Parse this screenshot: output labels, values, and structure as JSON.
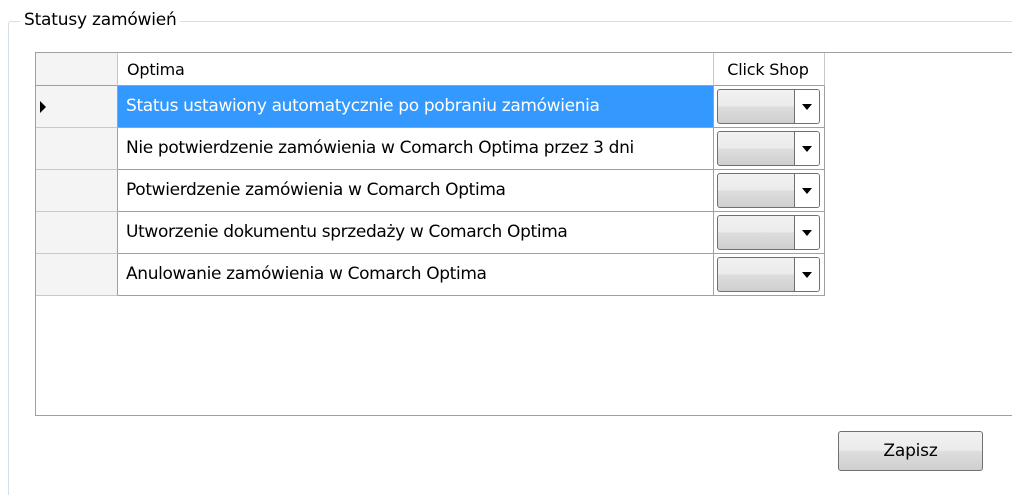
{
  "groupbox": {
    "title": "Statusy zamówień"
  },
  "grid": {
    "columns": [
      "Optima",
      "Click Shop"
    ],
    "rows": [
      {
        "optima": "Status ustawiony automatycznie po pobraniu zamówienia",
        "click_shop": "",
        "selected": true,
        "current": true
      },
      {
        "optima": "Nie potwierdzenie zamówienia w Comarch Optima przez 3 dni",
        "click_shop": "",
        "selected": false,
        "current": false
      },
      {
        "optima": "Potwierdzenie zamówienia w Comarch Optima",
        "click_shop": "",
        "selected": false,
        "current": false
      },
      {
        "optima": "Utworzenie dokumentu sprzedaży w Comarch Optima",
        "click_shop": "",
        "selected": false,
        "current": false
      },
      {
        "optima": "Anulowanie zamówienia w Comarch Optima",
        "click_shop": "",
        "selected": false,
        "current": false
      }
    ],
    "icons": {
      "current_row": "current-row-arrow-icon",
      "dropdown": "chevron-down-icon"
    },
    "colors": {
      "selection": "#3399ff",
      "selection_text": "#ffffff",
      "border": "#a0a0a0"
    }
  },
  "actions": {
    "save_label": "Zapisz"
  }
}
